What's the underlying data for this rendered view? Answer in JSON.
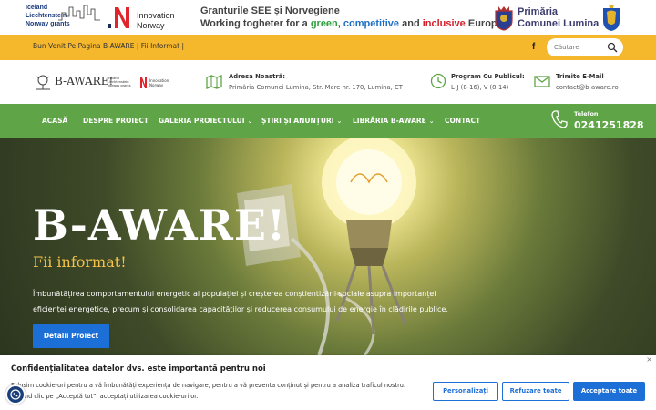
{
  "banner": {
    "eea_lines": [
      "Iceland",
      "Liechtenstein",
      "Norway grants"
    ],
    "eea_lines2": [
      "",
      "Norway",
      "Norway grants"
    ],
    "innovation_lines": [
      "Innovation",
      "Norway"
    ],
    "slogan_line1": "Granturile SEE și Norvegiene",
    "slogan_line2_parts": [
      "Working togheter for a ",
      "green",
      ", ",
      "competitive",
      " and ",
      "inclusive",
      " Europe"
    ],
    "primaria_lines": [
      "Primăria",
      "Comunei Lumina"
    ]
  },
  "topbar": {
    "welcome": "Bun Venit Pe Pagina B-AWARE | Fii Informat |",
    "facebook_glyph": "f",
    "search_placeholder": "Căutare"
  },
  "info": {
    "logo_text": "B-AWARE!",
    "logo_mini_lines": [
      "Iceland",
      "Liechtenstein",
      "Norway grants"
    ],
    "logo_innovation": [
      "Innovation",
      "Norway"
    ],
    "address_label": "Adresa Noastră:",
    "address_value": "Primăria Comunei Lumina, Str. Mare nr. 170, Lumina, CT",
    "hours_label": "Program Cu Publicul:",
    "hours_value": "L-J (8-16), V (8-14)",
    "email_label": "Trimite E-Mail",
    "email_value": "contact@b-aware.ro"
  },
  "nav": {
    "items": [
      {
        "label": "ACASĂ"
      },
      {
        "label": "DESPRE PROIECT"
      },
      {
        "label": "GALERIA PROIECTULUI"
      },
      {
        "label": "ȘTIRI ȘI ANUNȚURI"
      },
      {
        "label": "LIBRĂRIA B-AWARE"
      },
      {
        "label": "CONTACT"
      }
    ],
    "phone_label": "Telefon",
    "phone_number": "0241251828"
  },
  "hero": {
    "title": "B-AWARE!",
    "subtitle": "Fii informat!",
    "description": "Îmbunătățirea comportamentului energetic al populației și creșterea conștientizării sociale asupra importanței eficienței energetice, precum și consolidarea capacităților și reducerea consumului de energie în clădirile publice.",
    "button": "Detalii Proiect"
  },
  "cookie": {
    "title": "Confidențialitatea datelor dvs. este importantă pentru noi",
    "description": "Folosim cookie-uri pentru a vă îmbunătăți experiența de navigare, pentru a vă prezenta conținut și pentru a analiza traficul nostru. Făcând clic pe „Acceptă tot”, acceptați utilizarea cookie-urilor.",
    "close": "×",
    "customize": "Personalizați",
    "reject": "Refuzare toate",
    "accept": "Acceptare toate"
  },
  "colors": {
    "yellow": "#f5b72b",
    "green": "#5fa547",
    "blue": "#1d6fd8",
    "accent_text": "#f5c24a"
  }
}
